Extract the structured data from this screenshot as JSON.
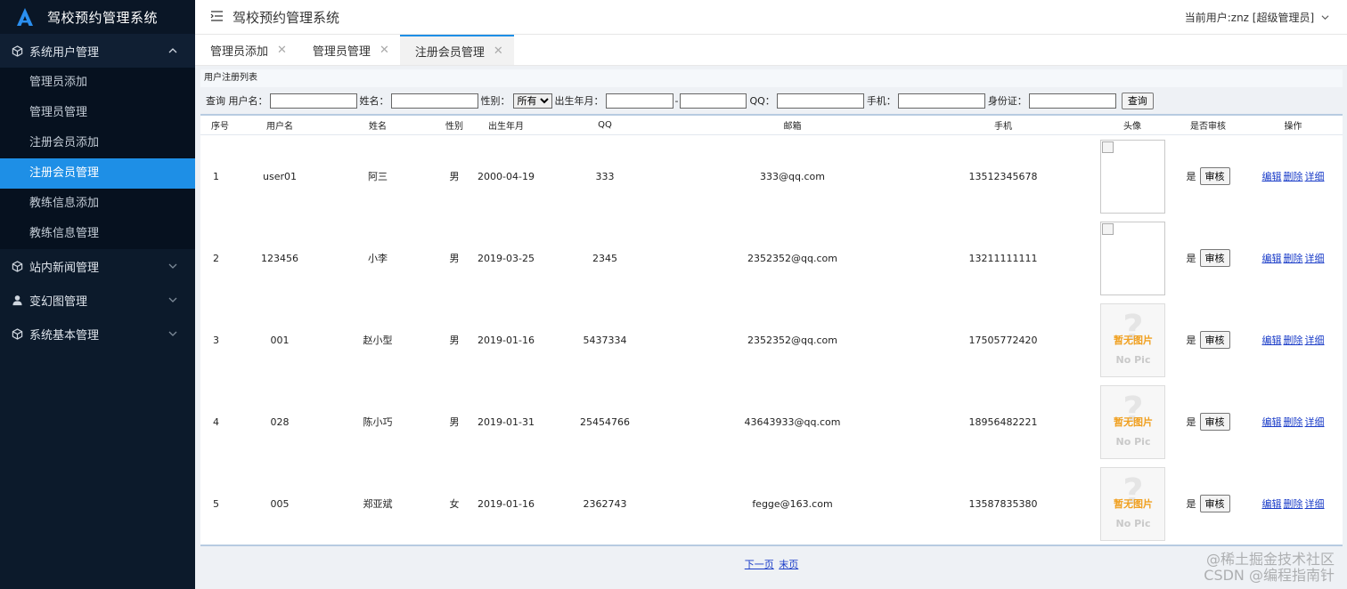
{
  "app": {
    "title": "驾校预约管理系统"
  },
  "header": {
    "title": "驾校预约管理系统",
    "user": "当前用户:znz [超级管理员]"
  },
  "sidebar": {
    "groups": [
      {
        "label": "系统用户管理",
        "icon": "cube-icon",
        "items": [
          "管理员添加",
          "管理员管理",
          "注册会员添加",
          "注册会员管理",
          "教练信息添加",
          "教练信息管理"
        ]
      },
      {
        "label": "站内新闻管理",
        "icon": "cube-icon"
      },
      {
        "label": "变幻图管理",
        "icon": "user-icon"
      },
      {
        "label": "系统基本管理",
        "icon": "cube-icon"
      }
    ],
    "active_item": "注册会员管理"
  },
  "tabs": [
    {
      "label": "管理员添加",
      "close": "✕"
    },
    {
      "label": "管理员管理",
      "close": "✕"
    },
    {
      "label": "注册会员管理",
      "close": "✕",
      "active": true
    }
  ],
  "list": {
    "title": "用户注册列表",
    "search": {
      "query_label": "查询",
      "username_label": "用户名：",
      "name_label": "姓名：",
      "gender_label": "性别：",
      "gender_selected": "所有",
      "birth_label": "出生年月：",
      "birth_sep": "-",
      "qq_label": "QQ：",
      "phone_label": "手机：",
      "idcard_label": "身份证：",
      "button": "查询"
    },
    "columns": [
      "序号",
      "用户名",
      "姓名",
      "性别",
      "出生年月",
      "QQ",
      "邮箱",
      "手机",
      "头像",
      "是否审核",
      "操作"
    ],
    "rows": [
      {
        "no": "1",
        "username": "user01",
        "name": "阿三",
        "gender": "男",
        "birth": "2000-04-19",
        "qq": "333",
        "email": "333@qq.com",
        "phone": "13512345678",
        "avatar": "broken",
        "audited": "是"
      },
      {
        "no": "2",
        "username": "123456",
        "name": "小李",
        "gender": "男",
        "birth": "2019-03-25",
        "qq": "2345",
        "email": "2352352@qq.com",
        "phone": "13211111111",
        "avatar": "broken",
        "audited": "是"
      },
      {
        "no": "3",
        "username": "001",
        "name": "赵小型",
        "gender": "男",
        "birth": "2019-01-16",
        "qq": "5437334",
        "email": "2352352@qq.com",
        "phone": "17505772420",
        "avatar": "nopic",
        "audited": "是"
      },
      {
        "no": "4",
        "username": "028",
        "name": "陈小巧",
        "gender": "男",
        "birth": "2019-01-31",
        "qq": "25454766",
        "email": "43643933@qq.com",
        "phone": "18956482221",
        "avatar": "nopic",
        "audited": "是"
      },
      {
        "no": "5",
        "username": "005",
        "name": "郑亚斌",
        "gender": "女",
        "birth": "2019-01-16",
        "qq": "2362743",
        "email": "fegge@163.com",
        "phone": "13587835380",
        "avatar": "nopic",
        "audited": "是"
      }
    ],
    "audit_button": "审核",
    "ops": [
      "编辑",
      "删除",
      "详细"
    ],
    "nopic": {
      "text1": "暂无图片",
      "text2": "No Pic"
    }
  },
  "pager": {
    "next": "下一页",
    "last": "末页"
  },
  "watermark": {
    "line1": "@稀土掘金技术社区",
    "line2": "CSDN @编程指南针"
  },
  "colors": {
    "sidebar_bg": "#0c1a2b",
    "accent": "#1e8fe6",
    "link": "#1a3cc8"
  }
}
